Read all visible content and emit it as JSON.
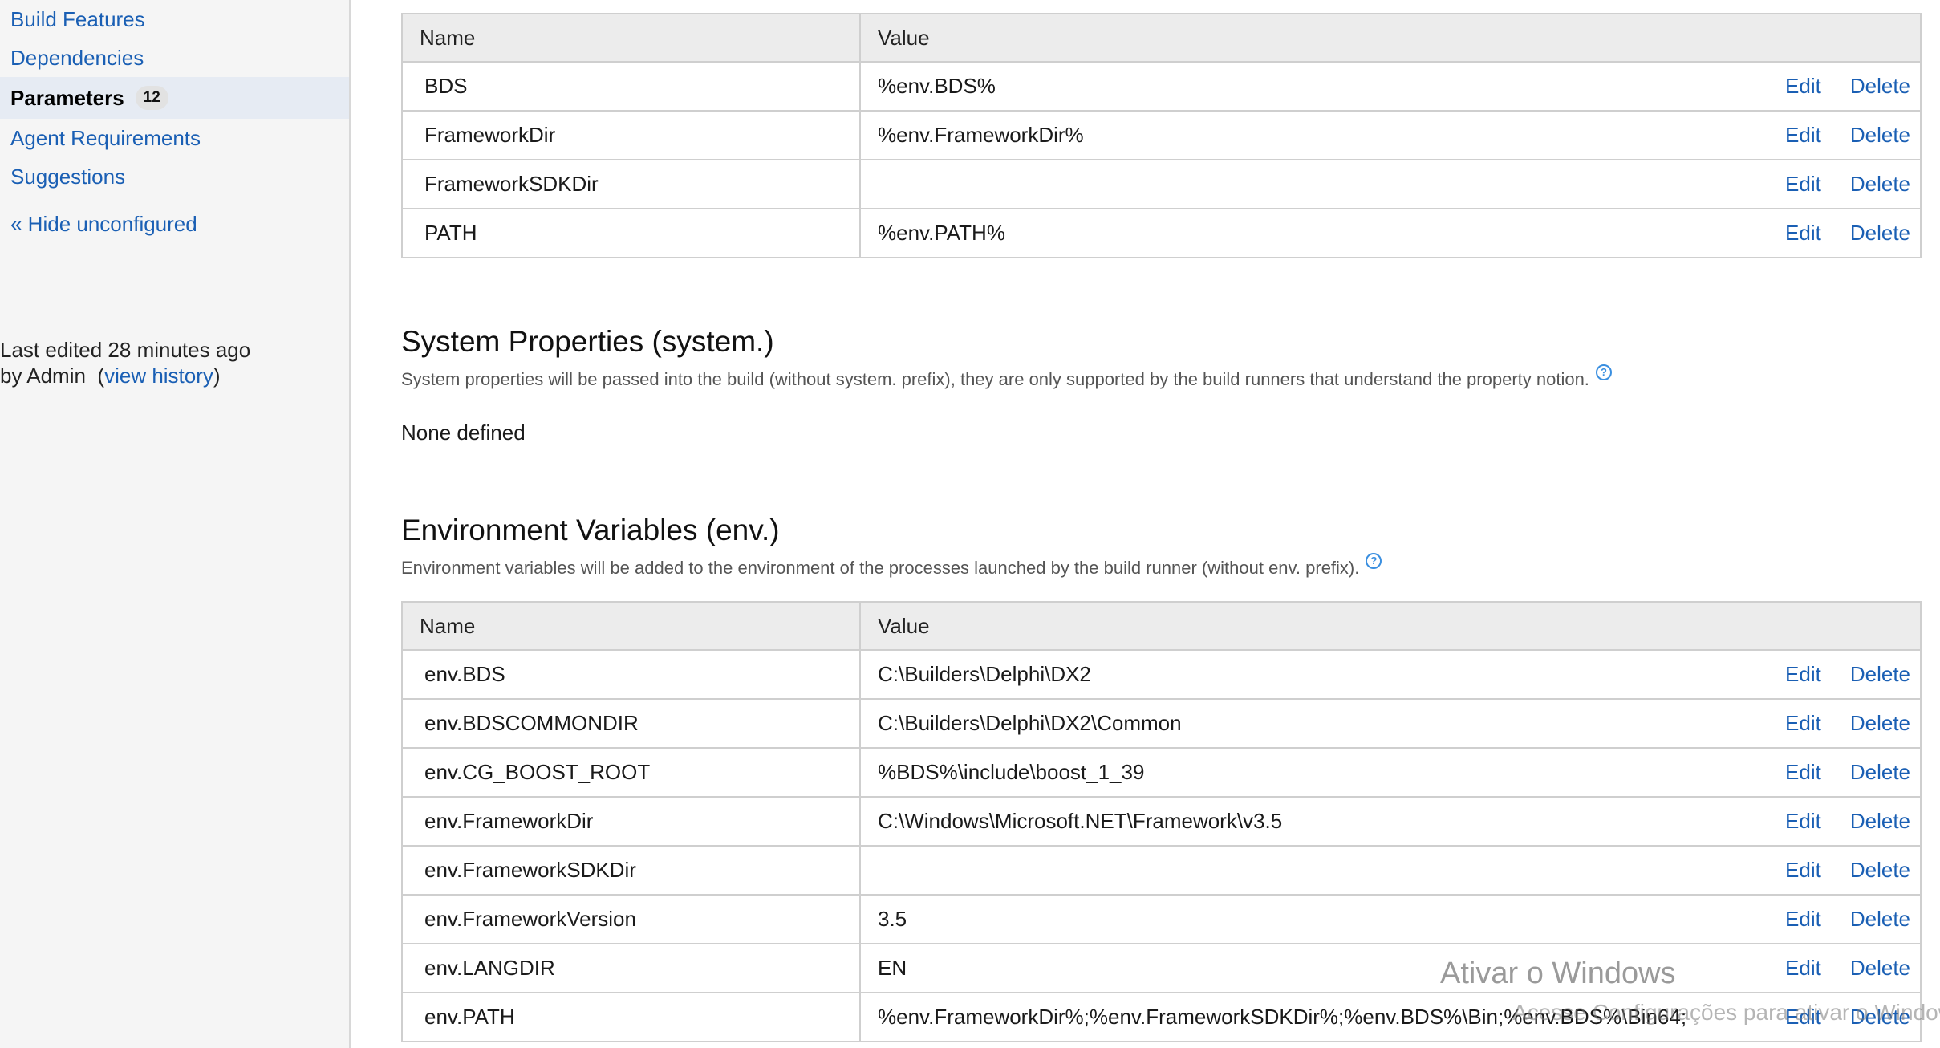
{
  "sidebar": {
    "items": [
      {
        "label": "Build Features"
      },
      {
        "label": "Dependencies"
      },
      {
        "label": "Parameters",
        "badge": "12"
      },
      {
        "label": "Agent Requirements"
      },
      {
        "label": "Suggestions"
      }
    ],
    "hide_link": "« Hide unconfigured",
    "last_edited": {
      "line1": "Last edited 28 minutes ago",
      "by": "by Admin",
      "open_paren": "(",
      "history_link": "view history",
      "close_paren": ")"
    }
  },
  "config_params": {
    "headers": {
      "name": "Name",
      "value": "Value"
    },
    "rows": [
      {
        "name": "BDS",
        "value": "%env.BDS%",
        "edit": "Edit",
        "delete": "Delete"
      },
      {
        "name": "FrameworkDir",
        "value": "%env.FrameworkDir%",
        "edit": "Edit",
        "delete": "Delete"
      },
      {
        "name": "FrameworkSDKDir",
        "value": "",
        "edit": "Edit",
        "delete": "Delete"
      },
      {
        "name": "PATH",
        "value": "%env.PATH%",
        "edit": "Edit",
        "delete": "Delete"
      }
    ]
  },
  "system_props": {
    "title": "System Properties (system.)",
    "description": "System properties will be passed into the build (without system. prefix), they are only supported by the build runners that understand the property notion.",
    "help_icon": "?",
    "none_defined": "None defined"
  },
  "env_vars": {
    "title": "Environment Variables (env.)",
    "description": "Environment variables will be added to the environment of the processes launched by the build runner (without env. prefix).",
    "help_icon": "?",
    "headers": {
      "name": "Name",
      "value": "Value"
    },
    "rows": [
      {
        "name": "env.BDS",
        "value": "C:\\Builders\\Delphi\\DX2",
        "edit": "Edit",
        "delete": "Delete"
      },
      {
        "name": "env.BDSCOMMONDIR",
        "value": "C:\\Builders\\Delphi\\DX2\\Common",
        "edit": "Edit",
        "delete": "Delete"
      },
      {
        "name": "env.CG_BOOST_ROOT",
        "value": "%BDS%\\include\\boost_1_39",
        "edit": "Edit",
        "delete": "Delete"
      },
      {
        "name": "env.FrameworkDir",
        "value": "C:\\Windows\\Microsoft.NET\\Framework\\v3.5",
        "edit": "Edit",
        "delete": "Delete"
      },
      {
        "name": "env.FrameworkSDKDir",
        "value": "",
        "edit": "Edit",
        "delete": "Delete"
      },
      {
        "name": "env.FrameworkVersion",
        "value": "3.5",
        "edit": "Edit",
        "delete": "Delete"
      },
      {
        "name": "env.LANGDIR",
        "value": "EN",
        "edit": "Edit",
        "delete": "Delete"
      },
      {
        "name": "env.PATH",
        "value": "%env.FrameworkDir%;%env.FrameworkSDKDir%;%env.BDS%\\Bin;%env.BDS%\\Bin64;",
        "edit": "Edit",
        "delete": "Delete"
      }
    ]
  },
  "watermark": {
    "title": "Ativar o Windows",
    "subtitle": "Acesse Configurações para ativar o Windows."
  },
  "colors": {
    "link": "#1a5fb4",
    "header_bg": "#ececec",
    "border": "#cfcfcf",
    "sidebar_bg": "#f5f5f5",
    "active_bg": "#e6ebf3"
  }
}
